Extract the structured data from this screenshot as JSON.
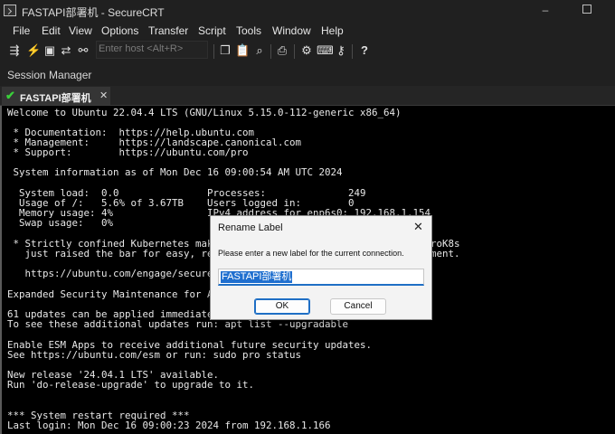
{
  "window": {
    "title": "FASTAPI部署机 - SecureCRT",
    "minimize": "–",
    "maximize_icon": "square-icon"
  },
  "menu": [
    "File",
    "Edit",
    "View",
    "Options",
    "Transfer",
    "Script",
    "Tools",
    "Window",
    "Help"
  ],
  "toolbar": {
    "host_placeholder": "Enter host <Alt+R>"
  },
  "session_manager": {
    "label": "Session Manager"
  },
  "tab": {
    "label": "FASTAPI部署机",
    "close": "✕",
    "status_icon": "check-icon",
    "status_color": "#3ad13a"
  },
  "terminal": {
    "lines": [
      "Welcome to Ubuntu 22.04.4 LTS (GNU/Linux 5.15.0-112-generic x86_64)",
      "",
      " * Documentation:  https://help.ubuntu.com",
      " * Management:     https://landscape.canonical.com",
      " * Support:        https://ubuntu.com/pro",
      "",
      " System information as of Mon Dec 16 09:00:54 AM UTC 2024",
      "",
      "  System load:  0.0               Processes:              249",
      "  Usage of /:   5.6% of 3.67TB    Users logged in:        0",
      "  Memory usage: 4%                IPv4 address for enp6s0: 192.168.1.154",
      "  Swap usage:   0%",
      "",
      " * Strictly confined Kubernetes makes edge and IoT secure. Learn how MicroK8s",
      "   just raised the bar for easy, resilient and secure K8s cluster deployment.",
      "",
      "   https://ubuntu.com/engage/secure-kubernetes-at-the-edge",
      "",
      "Expanded Security Maintenance for Applications is not enabled.",
      "",
      "61 updates can be applied immediately.",
      "To see these additional updates run: apt list --upgradable",
      "",
      "Enable ESM Apps to receive additional future security updates.",
      "See https://ubuntu.com/esm or run: sudo pro status",
      "",
      "New release '24.04.1 LTS' available.",
      "Run 'do-release-upgrade' to upgrade to it.",
      "",
      "",
      "*** System restart required ***",
      "Last login: Mon Dec 16 09:00:23 2024 from 192.168.1.166"
    ]
  },
  "dialog": {
    "title": "Rename Label",
    "close": "✕",
    "prompt": "Please enter a new label for the current connection.",
    "value": "FASTAPI部署机",
    "ok_label": "OK",
    "cancel_label": "Cancel"
  }
}
